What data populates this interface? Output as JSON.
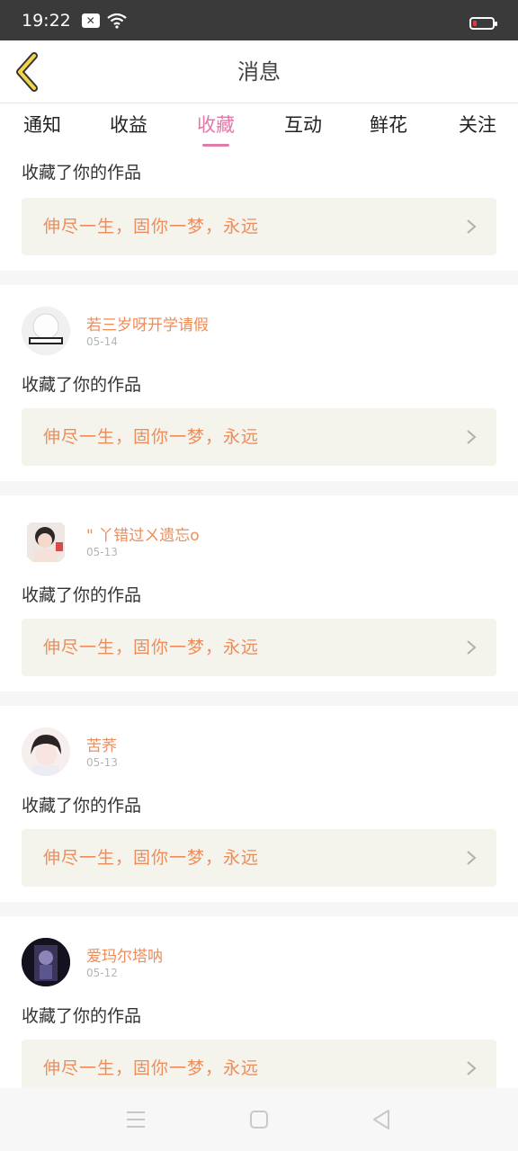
{
  "status_bar": {
    "time": "19:22",
    "icons": [
      "notification-icon",
      "wifi-icon",
      "battery-low-icon"
    ]
  },
  "header": {
    "title": "消息",
    "back_icon": "chevron-left-icon"
  },
  "tabs": [
    {
      "label": "通知",
      "active": false
    },
    {
      "label": "收益",
      "active": false
    },
    {
      "label": "收藏",
      "active": true
    },
    {
      "label": "互动",
      "active": false
    },
    {
      "label": "鲜花",
      "active": false
    },
    {
      "label": "关注",
      "active": false
    }
  ],
  "messages": [
    {
      "username": "",
      "date": "",
      "action": "收藏了你的作品",
      "work_title": "伸尽一生，固你一梦，永远"
    },
    {
      "username": "若三岁呀开学请假",
      "date": "05-14",
      "action": "收藏了你的作品",
      "work_title": "伸尽一生，固你一梦，永远"
    },
    {
      "username": "\" 丫错过ㄨ遗忘o",
      "date": "05-13",
      "action": "收藏了你的作品",
      "work_title": "伸尽一生，固你一梦，永远"
    },
    {
      "username": "苦荞",
      "date": "05-13",
      "action": "收藏了你的作品",
      "work_title": "伸尽一生，固你一梦，永远"
    },
    {
      "username": "爱玛尔塔呐",
      "date": "05-12",
      "action": "收藏了你的作品",
      "work_title": "伸尽一生，固你一梦，永远"
    }
  ],
  "colors": {
    "accent_pink": "#e07aa8",
    "username_orange": "#ee8c5a",
    "work_box_bg": "#f4f4ec",
    "back_arrow_yellow": "#f2d54a"
  },
  "navbar": {
    "icons": [
      "menu-icon",
      "home-square-icon",
      "back-triangle-icon"
    ]
  }
}
